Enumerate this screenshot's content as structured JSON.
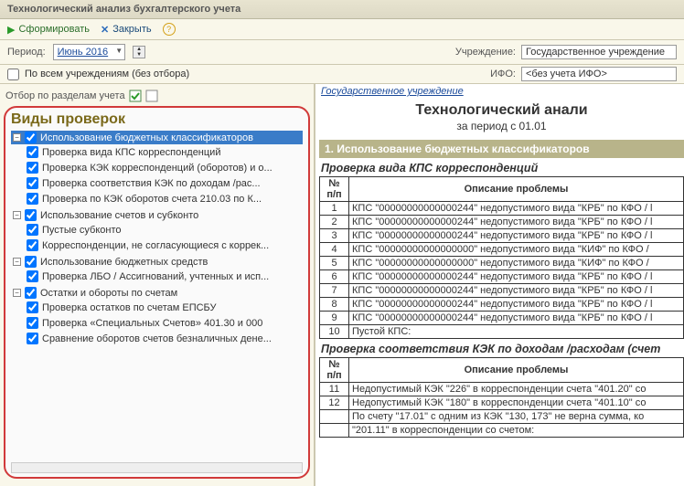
{
  "window_title": "Технологический анализ бухгалтерского учета",
  "actions": {
    "form": "Сформировать",
    "close": "Закрыть"
  },
  "params": {
    "period_label": "Период:",
    "period_value": "Июнь 2016",
    "org_label": "Учреждение:",
    "org_value": "Государственное учреждение",
    "ifo_label": "ИФО:",
    "ifo_value": "<без учета ИФО>"
  },
  "filters": {
    "all_orgs": "По всем учреждениям (без отбора)",
    "sections_label": "Отбор по разделам учета"
  },
  "tree": {
    "title": "Виды проверок",
    "groups": [
      {
        "label": "Использование бюджетных классификаторов",
        "selected": true,
        "children": [
          "Проверка вида КПС корреспонденций",
          "Проверка КЭК корреспонденций (оборотов) и о...",
          "Проверка соответствия КЭК по доходам /рас...",
          "Проверка по КЭК оборотов счета 210.03 по К..."
        ]
      },
      {
        "label": "Использование счетов и субконто",
        "children": [
          "Пустые субконто",
          "Корреспонденции, не согласующиеся с коррек..."
        ]
      },
      {
        "label": "Использование бюджетных средств",
        "children": [
          "Проверка ЛБО / Ассигнований, учтенных и исп..."
        ]
      },
      {
        "label": "Остатки и обороты по счетам",
        "children": [
          "Проверка остатков по счетам ЕПСБУ",
          "Проверка «Специальных Счетов» 401.30 и 000",
          "Сравнение оборотов счетов безналичных дене..."
        ]
      }
    ]
  },
  "report": {
    "header_link": "Государственное учреждение",
    "title": "Технологический анали",
    "subtitle": "за период с  01.01",
    "section1_title": "1. Использование бюджетных классификаторов",
    "table1_caption": "Проверка вида КПС корреспонденций",
    "col_num_h1": "№",
    "col_num_h2": "п/п",
    "col_desc": "Описание проблемы",
    "rows1": [
      {
        "n": "1",
        "d": "КПС \"00000000000000244\" недопустимого вида \"КРБ\" по КФО / l"
      },
      {
        "n": "2",
        "d": "КПС \"00000000000000244\" недопустимого вида \"КРБ\" по КФО / l"
      },
      {
        "n": "3",
        "d": "КПС \"00000000000000244\" недопустимого вида \"КРБ\" по КФО / l"
      },
      {
        "n": "4",
        "d": "КПС \"00000000000000000\" недопустимого вида \"КИФ\" по КФО / "
      },
      {
        "n": "5",
        "d": "КПС \"00000000000000000\" недопустимого вида \"КИФ\" по КФО / "
      },
      {
        "n": "6",
        "d": "КПС \"00000000000000244\" недопустимого вида \"КРБ\" по КФО / l"
      },
      {
        "n": "7",
        "d": "КПС \"00000000000000244\" недопустимого вида \"КРБ\" по КФО / l"
      },
      {
        "n": "8",
        "d": "КПС \"00000000000000244\" недопустимого вида \"КРБ\" по КФО / l"
      },
      {
        "n": "9",
        "d": "КПС \"00000000000000244\" недопустимого вида \"КРБ\" по КФО / l"
      },
      {
        "n": "10",
        "d": "Пустой КПС:"
      }
    ],
    "table2_caption": "Проверка соответствия КЭК по доходам /расходам (счет",
    "rows2": [
      {
        "n": "11",
        "d": "Недопустимый КЭК \"226\" в корреспонденции счета \"401.20\" со"
      },
      {
        "n": "12",
        "d": "Недопустимый КЭК \"180\" в корреспонденции счета \"401.10\" со"
      },
      {
        "n": "",
        "d": "По счету \"17.01\" с одним из КЭК \"130, 173\" не верна сумма, ко"
      },
      {
        "n": "",
        "d": "\"201.11\" в корреспонденции со счетом:"
      }
    ]
  }
}
